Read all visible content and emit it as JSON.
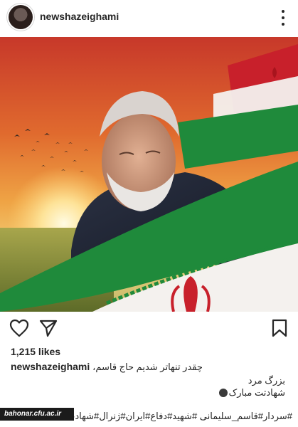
{
  "post": {
    "username": "newshazeighami",
    "likes": "1,215 likes"
  },
  "caption": {
    "username": "newshazeighami",
    "line1": "چقدر تنهاتر شدیم حاج قاسم،",
    "line2": "بزرگ مرد",
    "line3": "شهادتت مبارک",
    "hashtags": "#سردار#قاسم_سلیمانی #شهید#دفاع#ایران#ژنرال#شهادت"
  },
  "watermark": {
    "text": "bahonar.cfu.ac.ir"
  },
  "icons": {
    "avatar": "profile-avatar",
    "more": "more-options-icon",
    "like": "heart-icon",
    "share": "paper-plane-icon",
    "save": "bookmark-icon"
  },
  "colors": {
    "text": "#262626",
    "flag_green": "#1f8a3b",
    "flag_red": "#c8202b",
    "sunset_orange": "#e8862a"
  }
}
